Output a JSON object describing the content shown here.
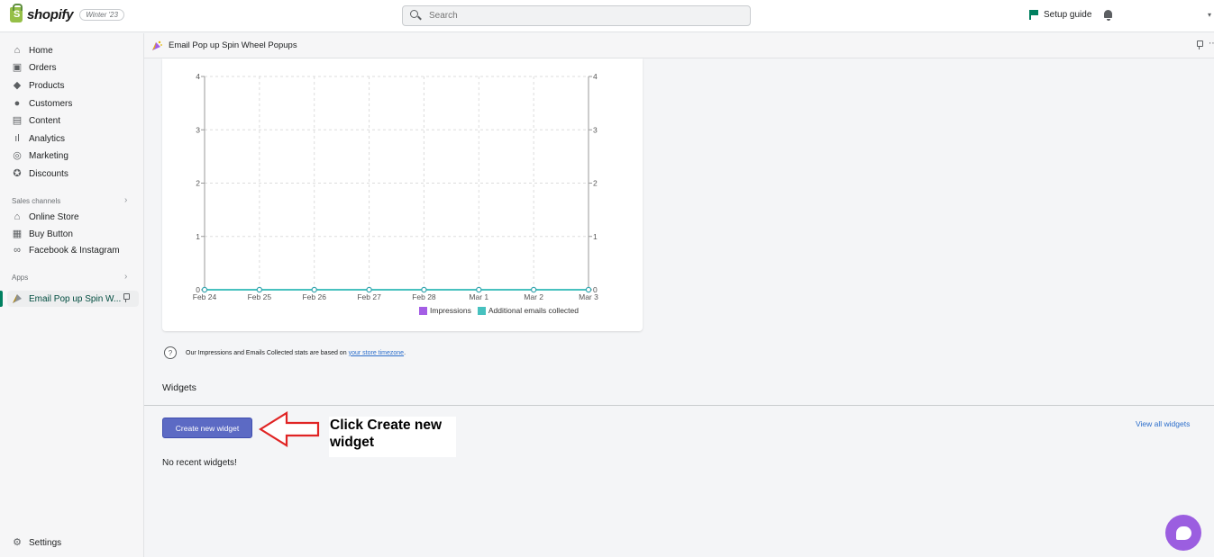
{
  "topbar": {
    "logo_text": "shopify",
    "logo_badge": "Winter '23",
    "search_placeholder": "Search",
    "setup_guide": "Setup guide"
  },
  "sidebar": {
    "main_items": [
      {
        "label": "Home",
        "icon": "home-icon"
      },
      {
        "label": "Orders",
        "icon": "orders-icon"
      },
      {
        "label": "Products",
        "icon": "tag-icon"
      },
      {
        "label": "Customers",
        "icon": "person-icon"
      },
      {
        "label": "Content",
        "icon": "image-icon"
      },
      {
        "label": "Analytics",
        "icon": "bar-chart-icon"
      },
      {
        "label": "Marketing",
        "icon": "target-icon"
      },
      {
        "label": "Discounts",
        "icon": "discount-icon"
      }
    ],
    "sales_channels_label": "Sales channels",
    "sales_channels": [
      {
        "label": "Online Store",
        "icon": "store-icon"
      },
      {
        "label": "Buy Button",
        "icon": "buy-button-icon"
      },
      {
        "label": "Facebook & Instagram",
        "icon": "meta-icon"
      }
    ],
    "apps_label": "Apps",
    "apps": [
      {
        "label": "Email Pop up Spin W...",
        "icon": "app-icon"
      }
    ],
    "settings_label": "Settings"
  },
  "appbar": {
    "title": "Email Pop up Spin Wheel Popups"
  },
  "chart_data": {
    "type": "line",
    "categories": [
      "Feb 24",
      "Feb 25",
      "Feb 26",
      "Feb 27",
      "Feb 28",
      "Mar 1",
      "Mar 2",
      "Mar 3"
    ],
    "series": [
      {
        "name": "Impressions",
        "values": [
          0,
          0,
          0,
          0,
          0,
          0,
          0,
          0
        ],
        "color": "#a45ee5"
      },
      {
        "name": "Additional emails collected",
        "values": [
          0,
          0,
          0,
          0,
          0,
          0,
          0,
          0
        ],
        "color": "#47c1bf"
      }
    ],
    "y_ticks": [
      "0",
      "1",
      "2",
      "3",
      "4"
    ],
    "y_right_ticks": [
      "0",
      "1",
      "2",
      "3",
      "4"
    ],
    "ylim": [
      0,
      4
    ],
    "grid": true,
    "legend_position": "bottom-right"
  },
  "info": {
    "text": "Our Impressions and Emails Collected stats are based on",
    "link": "your store timezone",
    "suffix": "."
  },
  "widgets": {
    "heading": "Widgets",
    "create_button": "Create new widget",
    "view_all": "View all widgets",
    "empty_text": "No recent widgets!"
  },
  "annotation": {
    "text": "Click Create new widget",
    "color": "#e02424"
  },
  "colors": {
    "accent": "#008060",
    "primary_button": "#5c6ac4",
    "chat": "#9b5ee0"
  }
}
